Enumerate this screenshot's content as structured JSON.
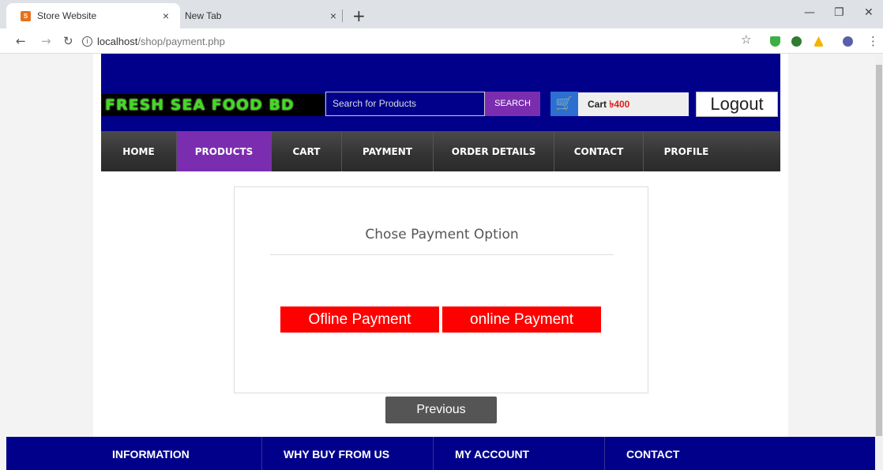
{
  "browser": {
    "active_tab": "Store Website",
    "favicon_text": "S",
    "inactive_tab": "New Tab",
    "close_glyph": "×",
    "new_tab_glyph": "+",
    "url_host": "localhost",
    "url_path": "/shop/payment.php"
  },
  "header": {
    "logo": "FRESH SEA FOOD BD",
    "search_placeholder": "Search for Products",
    "search_button": "SEARCH",
    "cart_label": "Cart",
    "cart_amount": "৳400",
    "logout": "Logout"
  },
  "menu": {
    "items": [
      "HOME",
      "PRODUCTS",
      "CART",
      "PAYMENT",
      "ORDER DETAILS",
      "CONTACT",
      "PROFILE"
    ],
    "active": "PRODUCTS"
  },
  "payment": {
    "title": "Chose Payment Option",
    "offline": "Ofline Payment",
    "online": "online Payment",
    "previous": "Previous"
  },
  "footer": {
    "columns": [
      "INFORMATION",
      "WHY BUY FROM US",
      "MY ACCOUNT",
      "CONTACT"
    ]
  },
  "colors": {
    "header_bg": "#00008b",
    "accent_purple": "#7b2db0",
    "pay_red": "#ff0000",
    "logo_green": "#3fdc22"
  }
}
